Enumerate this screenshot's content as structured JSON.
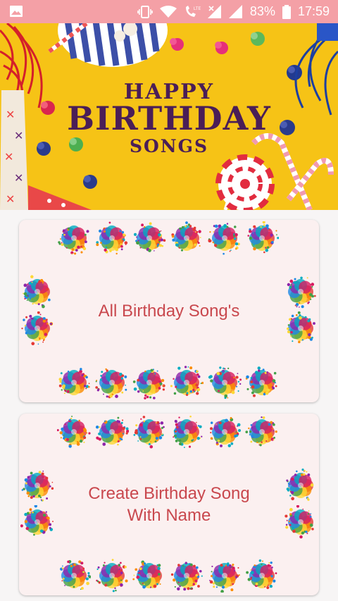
{
  "status_bar": {
    "battery_percent": "83%",
    "time": "17:59",
    "icons": [
      "gallery-icon",
      "vibrate-icon",
      "wifi-icon",
      "volte-call-icon",
      "signal-icon",
      "signal-icon",
      "battery-icon"
    ]
  },
  "banner": {
    "line1": "HAPPY",
    "line2": "BIRTHDAY",
    "line3": "SONGS"
  },
  "cards": [
    {
      "label": "All Birthday Song's"
    },
    {
      "label_line1": "Create Birthday Song",
      "label_line2": "With Name"
    }
  ],
  "colors": {
    "status_bar": "#f4a0a6",
    "banner_bg": "#f6c316",
    "title_text": "#4a1e57",
    "card_bg": "#fbf0f0",
    "card_text": "#c9484e"
  }
}
